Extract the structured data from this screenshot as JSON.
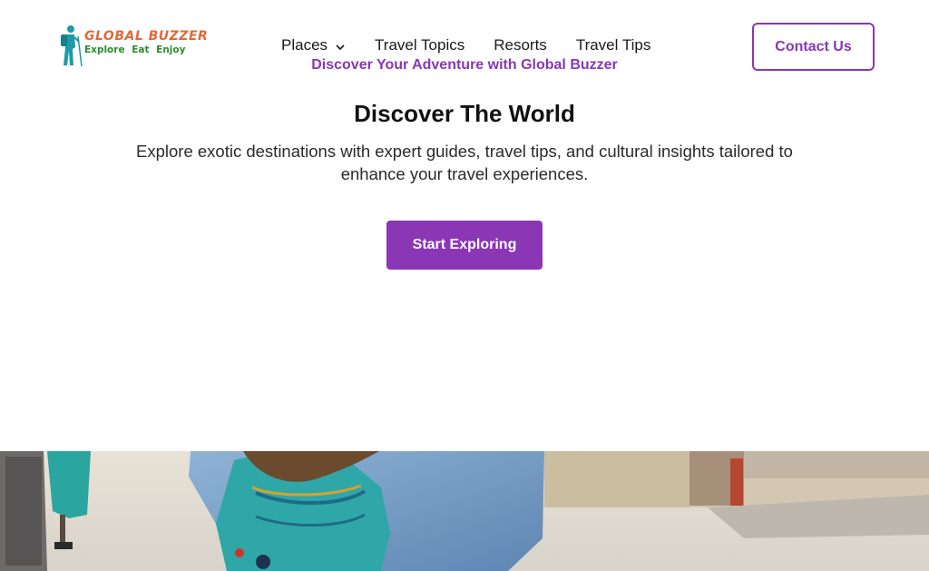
{
  "brand": {
    "name": "Global Buzzer",
    "logo_title": "GLOBAL BUZZER",
    "logo_tagline": "Explore Eat Enjoy",
    "accent_color": "#8a36b5"
  },
  "nav": {
    "items": [
      {
        "label": "Places",
        "has_dropdown": true
      },
      {
        "label": "Travel Topics"
      },
      {
        "label": "Resorts"
      },
      {
        "label": "Travel Tips"
      }
    ]
  },
  "header": {
    "contact_label": "Contact Us"
  },
  "hero": {
    "eyebrow": "Discover Your Adventure with Global Buzzer",
    "title": "Discover The World",
    "description": "Explore exotic destinations with expert guides, travel tips, and cultural insights tailored to enhance your travel experiences.",
    "cta_label": "Start Exploring"
  },
  "image": {
    "description_icon": "traveler-backpack-photo"
  }
}
